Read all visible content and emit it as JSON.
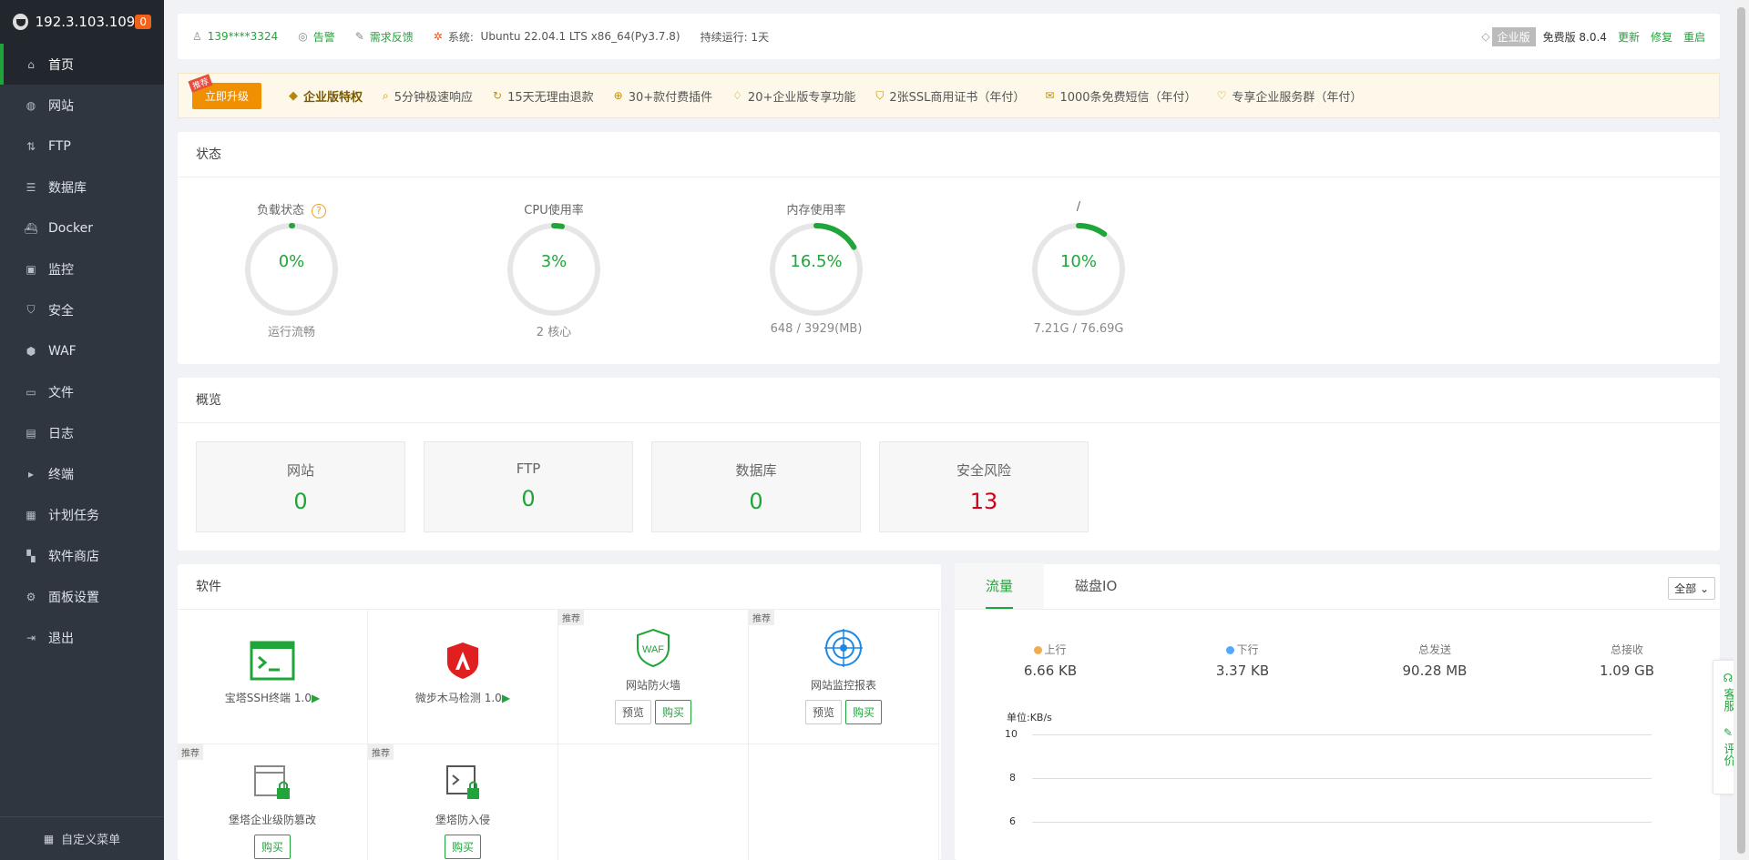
{
  "sidebar": {
    "host": "192.3.103.109",
    "badge": "0",
    "items": [
      {
        "label": "首页",
        "icon": "home-icon"
      },
      {
        "label": "网站",
        "icon": "globe-icon"
      },
      {
        "label": "FTP",
        "icon": "ftp-icon"
      },
      {
        "label": "数据库",
        "icon": "database-icon"
      },
      {
        "label": "Docker",
        "icon": "docker-icon"
      },
      {
        "label": "监控",
        "icon": "monitor-icon"
      },
      {
        "label": "安全",
        "icon": "shield-icon"
      },
      {
        "label": "WAF",
        "icon": "waf-icon"
      },
      {
        "label": "文件",
        "icon": "folder-icon"
      },
      {
        "label": "日志",
        "icon": "log-icon"
      },
      {
        "label": "终端",
        "icon": "terminal-icon"
      },
      {
        "label": "计划任务",
        "icon": "calendar-icon"
      },
      {
        "label": "软件商店",
        "icon": "apps-icon"
      },
      {
        "label": "面板设置",
        "icon": "gear-icon"
      },
      {
        "label": "退出",
        "icon": "logout-icon"
      }
    ],
    "footer": "自定义菜单"
  },
  "topbar": {
    "user": "139****3324",
    "alarm": "告警",
    "feedback": "需求反馈",
    "system_label": "系统:",
    "system": "Ubuntu 22.04.1 LTS x86_64(Py3.7.8)",
    "uptime": "持续运行: 1天",
    "edition": "企业版",
    "version": "免费版 8.0.4",
    "update": "更新",
    "repair": "修复",
    "restart": "重启"
  },
  "promo": {
    "tag": "推荐",
    "upgrade": "立即升级",
    "vip": "企业版特权",
    "items": [
      "5分钟极速响应",
      "15天无理由退款",
      "30+款付费插件",
      "20+企业版专享功能",
      "2张SSL商用证书（年付）",
      "1000条免费短信（年付）",
      "专享企业服务群（年付）"
    ]
  },
  "status": {
    "title": "状态",
    "gauges": [
      {
        "label": "负载状态",
        "value": "0%",
        "sub": "运行流畅",
        "percent": 0
      },
      {
        "label": "CPU使用率",
        "value": "3%",
        "sub": "2 核心",
        "percent": 3
      },
      {
        "label": "内存使用率",
        "value": "16.5%",
        "sub": "648 / 3929(MB)",
        "percent": 16.5
      },
      {
        "label": "/",
        "value": "10%",
        "sub": "7.21G / 76.69G",
        "percent": 10
      }
    ],
    "help": "?"
  },
  "overview": {
    "title": "概览",
    "cards": [
      {
        "label": "网站",
        "value": "0"
      },
      {
        "label": "FTP",
        "value": "0"
      },
      {
        "label": "数据库",
        "value": "0"
      },
      {
        "label": "安全风险",
        "value": "13"
      }
    ]
  },
  "software": {
    "title": "软件",
    "rec": "推荐",
    "preview": "预览",
    "buy": "购买",
    "items": [
      {
        "name": "宝塔SSH终端 1.0",
        "play": "▶"
      },
      {
        "name": "微步木马检测 1.0",
        "play": "▶"
      },
      {
        "name": "网站防火墙"
      },
      {
        "name": "网站监控报表"
      },
      {
        "name": "堡塔企业级防篡改"
      },
      {
        "name": "堡塔防入侵"
      }
    ],
    "waf_text": "WAF"
  },
  "traffic": {
    "tabs": [
      "流量",
      "磁盘IO"
    ],
    "select": "全部",
    "stats": [
      {
        "label": "上行",
        "value": "6.66 KB",
        "color": "#f0ad4e"
      },
      {
        "label": "下行",
        "value": "3.37 KB",
        "color": "#52a9ff"
      },
      {
        "label": "总发送",
        "value": "90.28 MB"
      },
      {
        "label": "总接收",
        "value": "1.09 GB"
      }
    ],
    "unit": "单位:KB/s",
    "y_ticks": [
      "10",
      "8",
      "6"
    ]
  },
  "float": {
    "service": "客服",
    "review": "评价"
  },
  "colors": {
    "accent": "#20a53a",
    "sidebar": "#2f3640",
    "danger": "#d0021b",
    "promo": "#f08f00"
  }
}
